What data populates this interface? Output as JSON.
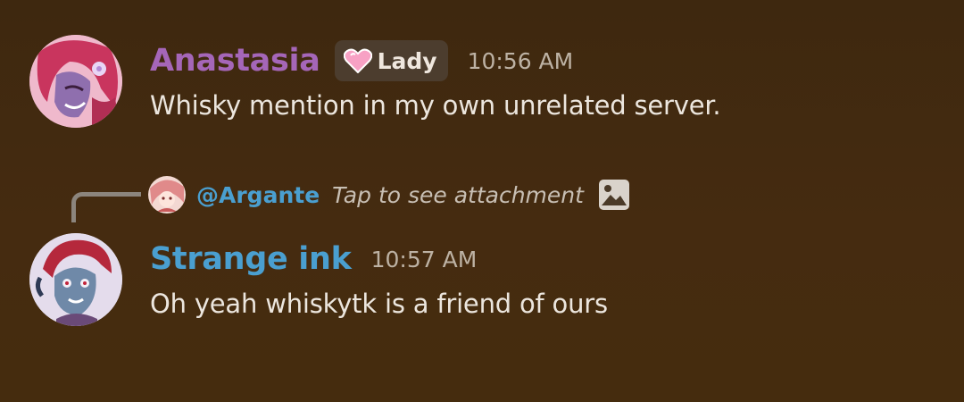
{
  "messages": [
    {
      "author": "Anastasia",
      "role_tag": "Lady",
      "timestamp": "10:56 AM",
      "content": "Whisky mention in my own unrelated server."
    },
    {
      "reply": {
        "author": "@Argante",
        "text": "Tap to see attachment"
      },
      "author": "Strange ink",
      "timestamp": "10:57 AM",
      "content": "Oh yeah whiskytk is a friend of ours"
    }
  ],
  "colors": {
    "background": "#452b10",
    "anastasia_name": "#a566b8",
    "strange_ink_name": "#4a9fd0",
    "mention": "#4a9fd0",
    "role_tag_bg": "#4c3d2e",
    "text": "#ece6de",
    "timestamp": "#bdb2a4"
  },
  "icons": {
    "role_tag_icon": "pink-heart-icon",
    "attachment_icon": "image-icon"
  }
}
